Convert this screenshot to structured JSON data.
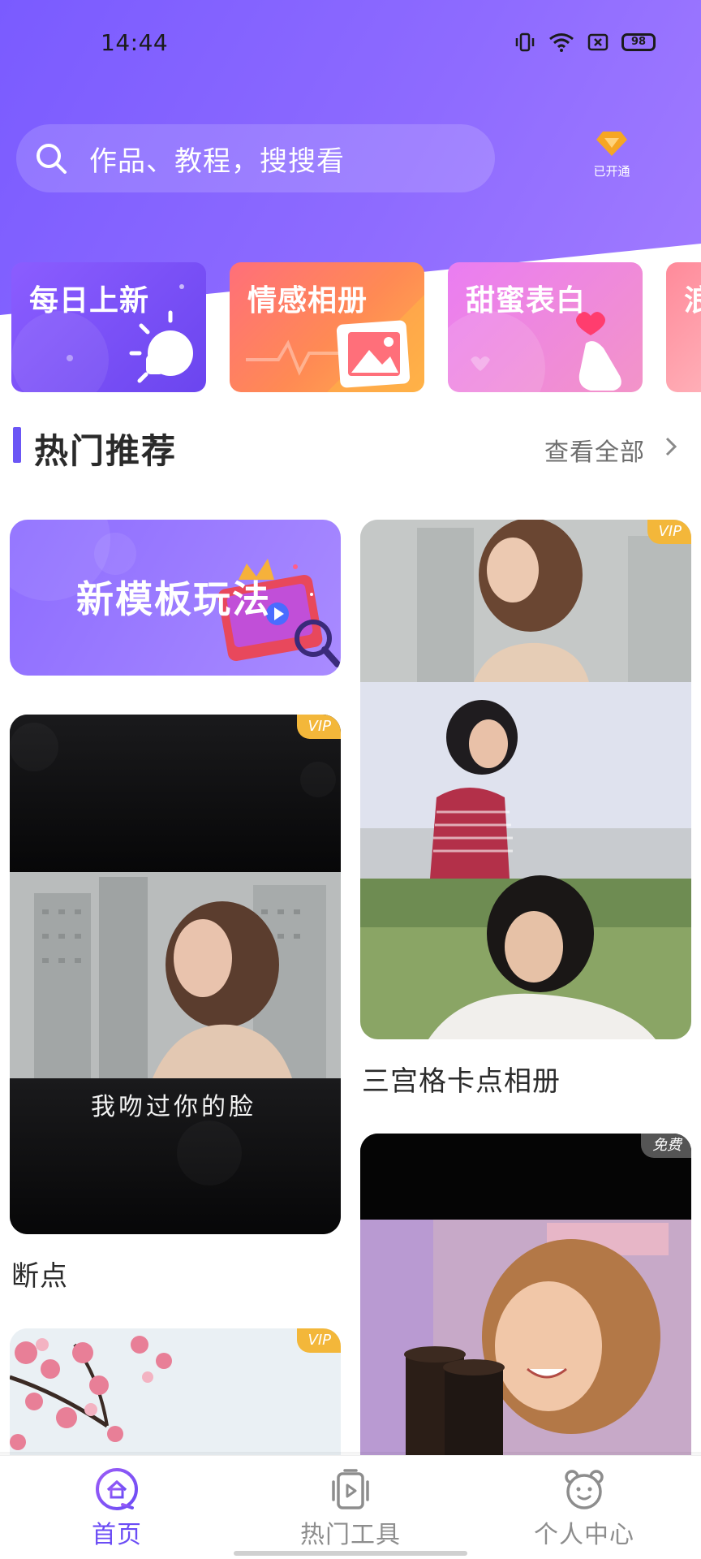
{
  "status_bar": {
    "time": "14:44",
    "battery": "98",
    "icons": [
      "vibrate-icon",
      "wifi-icon",
      "sim-off-icon",
      "battery-icon"
    ]
  },
  "search": {
    "placeholder": "作品、教程，搜搜看"
  },
  "vip": {
    "label": "已开通",
    "icon": "diamond-icon",
    "color": "#f6a623"
  },
  "categories": [
    {
      "label": "每日上新",
      "icon": "lightbulb-icon"
    },
    {
      "label": "情感相册",
      "icon": "photo-icon"
    },
    {
      "label": "甜蜜表白",
      "icon": "heart-hand-icon"
    },
    {
      "label": "浪"
    }
  ],
  "section": {
    "title": "热门推荐",
    "view_all": "查看全部"
  },
  "feed": {
    "promo": {
      "title": "新模板玩法"
    },
    "cards": [
      {
        "caption": "断点",
        "tag": "VIP",
        "overlay_text": "我吻过你的脸"
      },
      {
        "caption": "三宫格卡点相册",
        "tag": "VIP"
      },
      {
        "caption": "",
        "tag": "免费"
      },
      {
        "caption": "",
        "tag": "VIP"
      }
    ]
  },
  "tabs": [
    {
      "label": "首页",
      "icon": "home-icon",
      "active": true
    },
    {
      "label": "热门工具",
      "icon": "tools-icon",
      "active": false
    },
    {
      "label": "个人中心",
      "icon": "profile-bear-icon",
      "active": false
    }
  ],
  "colors": {
    "accent": "#6b4cf5",
    "header_gradient_start": "#7a5bff",
    "vip_tag": "#f3b73a"
  }
}
